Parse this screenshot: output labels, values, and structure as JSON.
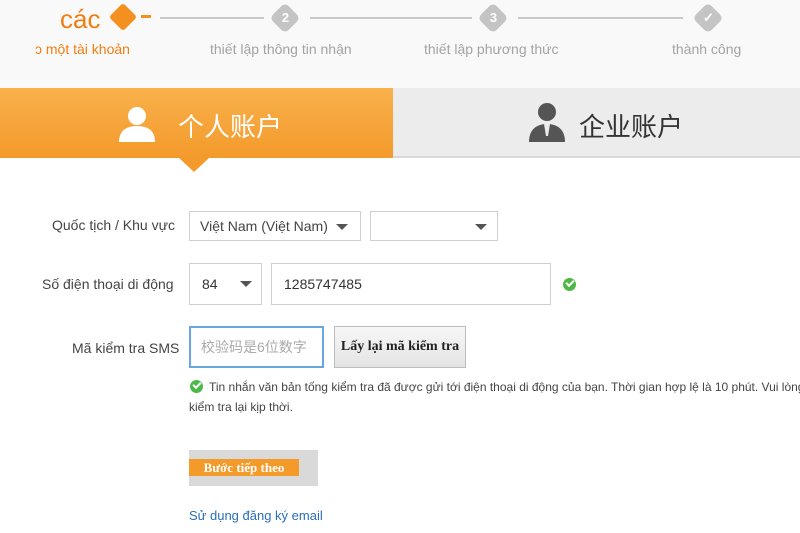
{
  "steps": {
    "title": "các",
    "items": [
      {
        "label": "ɔ một tài khoản",
        "number": ""
      },
      {
        "label": "thiết lập thông tin nhận",
        "number": "2"
      },
      {
        "label": "thiết lập phương thức",
        "number": "3"
      },
      {
        "label": "thành công",
        "number": "✓"
      }
    ]
  },
  "tabs": {
    "personal": {
      "label": "个人账户",
      "icon": "user-icon"
    },
    "business": {
      "label": "企业账户",
      "icon": "businessman-icon"
    }
  },
  "form": {
    "nationality": {
      "label": "Quốc tịch / Khu vực",
      "country_value": "Việt Nam (Việt Nam)",
      "region_value": ""
    },
    "phone": {
      "label": "Số điện thoại di động",
      "code_value": "84",
      "number_value": "1285747485"
    },
    "sms": {
      "label": "Mã kiểm tra SMS",
      "placeholder": "校验码是6位数字",
      "button_label": "Lấy lại mã kiểm tra"
    },
    "notice": "Tin nhắn văn bản tống kiểm tra đã được gửi tới điện thoại di động của bạn. Thời gian hợp lệ là 10 phút. Vui lòng kiểm tra lại kịp thời.",
    "next_label": "Bước tiếp theo",
    "email_link": "Sử dụng đăng ký email"
  },
  "colors": {
    "accent": "#f39a2b",
    "success": "#4db848",
    "link": "#2a6fb6"
  }
}
